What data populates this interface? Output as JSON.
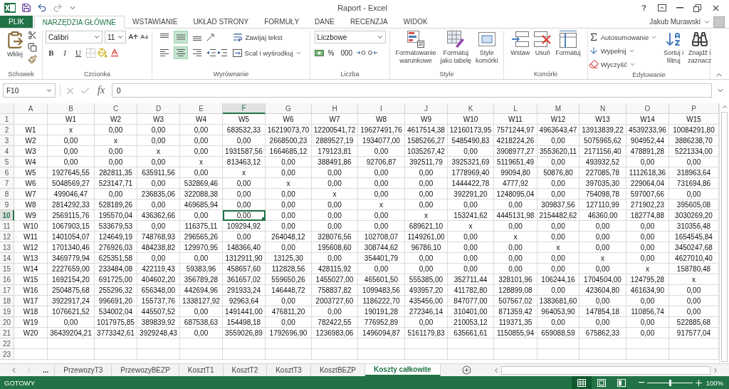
{
  "window": {
    "title": "Raport - Excel",
    "help": "?",
    "user": "Jakub Murawski"
  },
  "tabs": [
    {
      "label": "PLIK",
      "kind": "file",
      "selected": false
    },
    {
      "label": "NARZĘDZIA GŁÓWNE",
      "kind": "tab",
      "selected": true
    },
    {
      "label": "WSTAWIANIE",
      "kind": "tab",
      "selected": false
    },
    {
      "label": "UKŁAD STRONY",
      "kind": "tab",
      "selected": false
    },
    {
      "label": "FORMUŁY",
      "kind": "tab",
      "selected": false
    },
    {
      "label": "DANE",
      "kind": "tab",
      "selected": false
    },
    {
      "label": "RECENZJA",
      "kind": "tab",
      "selected": false
    },
    {
      "label": "WIDOK",
      "kind": "tab",
      "selected": false
    }
  ],
  "ribbon": {
    "clipboard": {
      "paste": "Wklej",
      "label": "Schowek"
    },
    "font": {
      "name": "Calibri",
      "size": "11",
      "styles": [
        "B",
        "I",
        "U"
      ],
      "label": "Czcionka"
    },
    "alignment": {
      "vertical": [
        {
          "selected": false
        },
        {
          "selected": true
        },
        {
          "selected": false
        }
      ],
      "horizontal": [
        {
          "selected": false
        },
        {
          "selected": true
        },
        {
          "selected": false
        }
      ],
      "wrap": "Zawijaj tekst",
      "merge": "Scal i wyśrodkuj",
      "label": "Wyrównanie"
    },
    "number": {
      "format": "Liczbowe",
      "percent": "%",
      "thousands": "000",
      "label": "Liczba"
    },
    "styles": {
      "buttons": [
        {
          "kind": "conditional",
          "lines": [
            "Formatowanie",
            "warunkowe"
          ]
        },
        {
          "kind": "table",
          "lines": [
            "Formatuj",
            "jako tabelę"
          ]
        },
        {
          "kind": "cell",
          "lines": [
            "Style",
            "komórki"
          ]
        }
      ],
      "label": "Style"
    },
    "cells": {
      "buttons": [
        {
          "kind": "insert",
          "label": "Wstaw"
        },
        {
          "kind": "delete",
          "label": "Usuń"
        },
        {
          "kind": "format",
          "label": "Formatuj"
        }
      ],
      "label": "Komórki"
    },
    "editing": {
      "items": [
        {
          "kind": "sum",
          "label": "Autosumowanie"
        },
        {
          "kind": "fill",
          "label": "Wypełnij"
        },
        {
          "kind": "clear",
          "label": "Wyczyść"
        }
      ],
      "buttons": [
        {
          "kind": "sort",
          "lines": [
            "Sortuj i",
            "filtruj"
          ]
        },
        {
          "kind": "find",
          "lines": [
            "Znajdź i",
            "zaznacz"
          ]
        }
      ],
      "label": "Edytowanie"
    }
  },
  "formula_bar": {
    "name_box": "F10",
    "function_label": "fx",
    "value": "0"
  },
  "sheet": {
    "column_headers": [
      {
        "label": "A",
        "selected": false
      },
      {
        "label": "B",
        "selected": false
      },
      {
        "label": "C",
        "selected": false
      },
      {
        "label": "D",
        "selected": false
      },
      {
        "label": "E",
        "selected": false
      },
      {
        "label": "F",
        "selected": true
      },
      {
        "label": "G",
        "selected": false
      },
      {
        "label": "H",
        "selected": false
      },
      {
        "label": "I",
        "selected": false
      },
      {
        "label": "J",
        "selected": false
      },
      {
        "label": "K",
        "selected": false
      },
      {
        "label": "L",
        "selected": false
      },
      {
        "label": "M",
        "selected": false
      },
      {
        "label": "N",
        "selected": false
      },
      {
        "label": "O",
        "selected": false
      },
      {
        "label": "P",
        "selected": false
      }
    ],
    "rows": [
      {
        "number": "1",
        "selected": false,
        "values": [
          "W1",
          "W2",
          "W3",
          "W4",
          "W5",
          "W6",
          "W7",
          "W8",
          "W9",
          "W10",
          "W11",
          "W12",
          "W13",
          "W14",
          "W15"
        ]
      },
      {
        "number": "2",
        "selected": false,
        "label": "W1",
        "values": [
          "x",
          "0,00",
          "0,00",
          "0,00",
          "683532,33",
          "16219073,70",
          "12200541,72",
          "19627491,76",
          "4617514,38",
          "12160173,95",
          "7571244,97",
          "4963643,47",
          "13913839,22",
          "4539233,96",
          "10084291,80"
        ]
      },
      {
        "number": "3",
        "selected": false,
        "label": "W2",
        "values": [
          "0,00",
          "x",
          "0,00",
          "0,00",
          "0,00",
          "2668500,23",
          "2889527,19",
          "1934077,00",
          "1585266,27",
          "5485490,83",
          "4218224,26",
          "0,00",
          "5075965,62",
          "904952,44",
          "3886238,70"
        ]
      },
      {
        "number": "4",
        "selected": false,
        "label": "W3",
        "values": [
          "0,00",
          "0,00",
          "x",
          "0,00",
          "1931587,56",
          "1664685,12",
          "179123,81",
          "0,00",
          "1035267,42",
          "0,00",
          "3908977,27",
          "3553620,11",
          "2171156,40",
          "478891,28",
          "5221334,00"
        ]
      },
      {
        "number": "5",
        "selected": false,
        "label": "W4",
        "values": [
          "0,00",
          "0,00",
          "0,00",
          "x",
          "813463,12",
          "0,00",
          "388491,86",
          "92706,87",
          "392511,79",
          "3925321,69",
          "5119651,49",
          "0,00",
          "493932,52",
          "0,00",
          "0,00"
        ]
      },
      {
        "number": "6",
        "selected": false,
        "label": "W5",
        "values": [
          "1927645,55",
          "282811,35",
          "635911,56",
          "0,00",
          "x",
          "0,00",
          "0,00",
          "0,00",
          "0,00",
          "1778969,40",
          "99094,80",
          "50876,80",
          "227085,78",
          "1112618,36",
          "318963,64"
        ]
      },
      {
        "number": "7",
        "selected": false,
        "label": "W6",
        "values": [
          "5048569,27",
          "523147,71",
          "0,00",
          "532869,46",
          "0,00",
          "x",
          "0,00",
          "0,00",
          "0,00",
          "1444422,78",
          "4777,92",
          "0,00",
          "397035,30",
          "229064,04",
          "731694,86"
        ]
      },
      {
        "number": "8",
        "selected": false,
        "label": "W7",
        "values": [
          "499046,47",
          "0,00",
          "236835,06",
          "322088,38",
          "0,00",
          "0,00",
          "x",
          "0,00",
          "0,00",
          "392291,20",
          "1248095,04",
          "0,00",
          "754098,78",
          "597007,66",
          "0,00"
        ]
      },
      {
        "number": "9",
        "selected": false,
        "label": "W8",
        "values": [
          "2814292,33",
          "528189,26",
          "0,00",
          "469685,94",
          "0,00",
          "0,00",
          "0,00",
          "x",
          "0,00",
          "0,00",
          "0,00",
          "309837,56",
          "127110,99",
          "271902,23",
          "395605,08"
        ]
      },
      {
        "number": "10",
        "selected": true,
        "label": "W9",
        "values": [
          "2569115,76",
          "195570,04",
          "436362,66",
          "0,00",
          "0,00",
          "0,00",
          "0,00",
          "0,00",
          "x",
          "153241,62",
          "4445131,98",
          "2154482,62",
          "46360,00",
          "182774,88",
          "3030269,20"
        ]
      },
      {
        "number": "11",
        "selected": false,
        "label": "W10",
        "values": [
          "1067903,15",
          "533679,53",
          "0,00",
          "116375,11",
          "109294,92",
          "0,00",
          "0,00",
          "0,00",
          "689621,10",
          "x",
          "0,00",
          "0,00",
          "0,00",
          "0,00",
          "310356,48"
        ]
      },
      {
        "number": "12",
        "selected": false,
        "label": "W11",
        "values": [
          "1401054,07",
          "124649,19",
          "748768,93",
          "296565,26",
          "0,00",
          "264048,12",
          "328076,56",
          "102708,07",
          "1149261,00",
          "0,00",
          "x",
          "0,00",
          "0,00",
          "0,00",
          "1654545,84"
        ]
      },
      {
        "number": "13",
        "selected": false,
        "label": "W12",
        "values": [
          "1701340,46",
          "276926,03",
          "484238,82",
          "129970,95",
          "148366,40",
          "0,00",
          "195608,60",
          "308744,62",
          "96786,10",
          "0,00",
          "0,00",
          "x",
          "0,00",
          "0,00",
          "3450247,68"
        ]
      },
      {
        "number": "14",
        "selected": false,
        "label": "W13",
        "values": [
          "3469779,94",
          "625351,58",
          "0,00",
          "0,00",
          "1312911,90",
          "13125,30",
          "0,00",
          "354401,79",
          "0,00",
          "0,00",
          "0,00",
          "0,00",
          "x",
          "0,00",
          "4627010,40"
        ]
      },
      {
        "number": "15",
        "selected": false,
        "label": "W14",
        "values": [
          "2227659,00",
          "233484,08",
          "422119,43",
          "59383,96",
          "458657,60",
          "112828,56",
          "428115,92",
          "0,00",
          "0,00",
          "0,00",
          "0,00",
          "0,00",
          "0,00",
          "x",
          "158780,48"
        ]
      },
      {
        "number": "16",
        "selected": false,
        "label": "W15",
        "values": [
          "1692154,20",
          "691725,00",
          "404602,20",
          "356789,28",
          "361657,02",
          "559650,26",
          "1455027,00",
          "465601,50",
          "555385,00",
          "352711,44",
          "328101,96",
          "106244,16",
          "1704504,00",
          "124795,28",
          "x"
        ]
      },
      {
        "number": "17",
        "selected": false,
        "label": "W16",
        "values": [
          "2504875,68",
          "255296,32",
          "656348,00",
          "442694,96",
          "291933,24",
          "146448,72",
          "758837,82",
          "1099483,56",
          "493957,20",
          "411782,80",
          "128899,08",
          "0,00",
          "423604,80",
          "461634,90",
          "0,00"
        ]
      },
      {
        "number": "18",
        "selected": false,
        "label": "W17",
        "values": [
          "3922917,24",
          "996691,20",
          "155737,76",
          "1338127,92",
          "92963,64",
          "0,00",
          "2003727,60",
          "1186222,70",
          "435456,00",
          "847077,00",
          "507567,02",
          "1383681,60",
          "0,00",
          "0,00",
          "0,00"
        ]
      },
      {
        "number": "19",
        "selected": false,
        "label": "W18",
        "values": [
          "1076621,52",
          "534002,04",
          "445507,52",
          "0,00",
          "1491441,00",
          "476811,20",
          "0,00",
          "190191,28",
          "272346,14",
          "310401,00",
          "871359,42",
          "964053,90",
          "147854,18",
          "110856,74",
          "0,00"
        ]
      },
      {
        "number": "20",
        "selected": false,
        "label": "W19",
        "values": [
          "0,00",
          "1017975,85",
          "389839,92",
          "687538,63",
          "154498,18",
          "0,00",
          "782422,55",
          "776952,89",
          "0,00",
          "210053,12",
          "119371,35",
          "0,00",
          "0,00",
          "0,00",
          "522885,68"
        ]
      },
      {
        "number": "21",
        "selected": false,
        "label": "W20",
        "values": [
          "36439204,21",
          "3773342,61",
          "3929248,43",
          "0,00",
          "3559026,89",
          "1792696,90",
          "1236983,06",
          "1496094,87",
          "5161179,83",
          "635661,61",
          "1150855,94",
          "659088,59",
          "675862,33",
          "0,00",
          "917577,04"
        ]
      },
      {
        "number": "22",
        "selected": false
      },
      {
        "number": "23",
        "selected": false
      }
    ]
  },
  "sheet_tabs": [
    {
      "label": "...",
      "kind": "more",
      "selected": false
    },
    {
      "label": "PrzewozyT3",
      "kind": "sheet",
      "selected": false
    },
    {
      "label": "PrzewozyBEZP",
      "kind": "sheet",
      "selected": false
    },
    {
      "label": "KosztT1",
      "kind": "sheet",
      "selected": false
    },
    {
      "label": "KosztT2",
      "kind": "sheet",
      "selected": false
    },
    {
      "label": "KosztT3",
      "kind": "sheet",
      "selected": false
    },
    {
      "label": "KosztBEZP",
      "kind": "sheet",
      "selected": false
    },
    {
      "label": "Koszty całkowite",
      "kind": "sheet",
      "selected": true
    }
  ],
  "status_bar": {
    "status": "GOTOWY",
    "views": [
      {
        "kind": "normal",
        "selected": true
      },
      {
        "kind": "layout",
        "selected": false
      },
      {
        "kind": "break",
        "selected": false
      }
    ],
    "zoom": {
      "level": 0.5,
      "reading": "100%"
    }
  }
}
